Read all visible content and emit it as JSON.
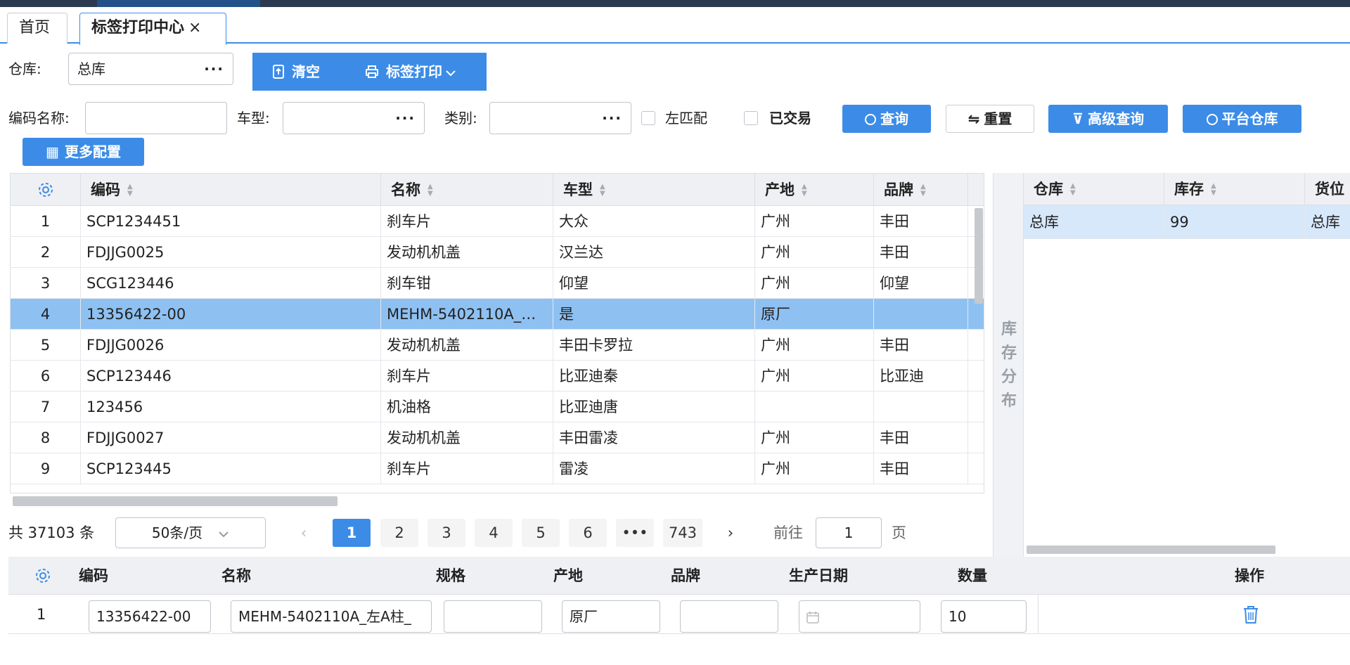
{
  "tabs": {
    "home": "首页",
    "active": "标签打印中心",
    "close": "×"
  },
  "warehouse": {
    "label": "仓库:",
    "value": "总库",
    "dots": "···"
  },
  "toolbar": {
    "clear": "清空",
    "print": "标签打印"
  },
  "filters": {
    "code_name_label": "编码名称:",
    "model_label": "车型:",
    "category_label": "类别:",
    "dots": "···",
    "left_match": "左匹配",
    "traded": "已交易",
    "query": "查询",
    "reset": "重置",
    "advanced": "高级查询",
    "platform": "平台仓库",
    "more": "更多配置"
  },
  "main_table": {
    "headers": [
      "编码",
      "名称",
      "车型",
      "产地",
      "品牌"
    ],
    "rows": [
      {
        "n": "1",
        "code": "SCP1234451",
        "name": "刹车片",
        "model": "大众",
        "origin": "广州",
        "brand": "丰田"
      },
      {
        "n": "2",
        "code": "FDJJG0025",
        "name": "发动机机盖",
        "model": "汉兰达",
        "origin": "广州",
        "brand": "丰田"
      },
      {
        "n": "3",
        "code": "SCG123446",
        "name": "刹车钳",
        "model": "仰望",
        "origin": "广州",
        "brand": "仰望"
      },
      {
        "n": "4",
        "code": "13356422-00",
        "name": "MEHM-5402110A_…",
        "model": "是",
        "origin": "原厂",
        "brand": ""
      },
      {
        "n": "5",
        "code": "FDJJG0026",
        "name": "发动机机盖",
        "model": "丰田卡罗拉",
        "origin": "广州",
        "brand": "丰田"
      },
      {
        "n": "6",
        "code": "SCP123446",
        "name": "刹车片",
        "model": "比亚迪秦",
        "origin": "广州",
        "brand": "比亚迪"
      },
      {
        "n": "7",
        "code": "123456",
        "name": "机油格",
        "model": "比亚迪唐",
        "origin": "",
        "brand": ""
      },
      {
        "n": "8",
        "code": "FDJJG0027",
        "name": "发动机机盖",
        "model": "丰田雷凌",
        "origin": "广州",
        "brand": "丰田"
      },
      {
        "n": "9",
        "code": "SCP123445",
        "name": "刹车片",
        "model": "雷凌",
        "origin": "广州",
        "brand": "丰田"
      }
    ],
    "selected_index": 3
  },
  "pager": {
    "total": "共 37103 条",
    "page_size": "50条/页",
    "pages": [
      "1",
      "2",
      "3",
      "4",
      "5",
      "6",
      "•••",
      "743"
    ],
    "goto_label": "前往",
    "goto_value": "1",
    "goto_unit": "页"
  },
  "side_panel": {
    "label": "库存分布"
  },
  "stock_table": {
    "headers": [
      "仓库",
      "库存",
      "货位"
    ],
    "row": [
      "总库",
      "99",
      "总库"
    ]
  },
  "bottom_table": {
    "headers": [
      "编码",
      "名称",
      "规格",
      "产地",
      "品牌",
      "生产日期",
      "数量",
      "操作"
    ],
    "row": {
      "n": "1",
      "code": "13356422-00",
      "name": "MEHM-5402110A_左A柱_",
      "spec": "",
      "origin": "原厂",
      "brand": "",
      "date": "",
      "qty": "10"
    }
  },
  "colors": {
    "accent": "#3c8ce7",
    "selected_row": "#8ec1f2"
  }
}
